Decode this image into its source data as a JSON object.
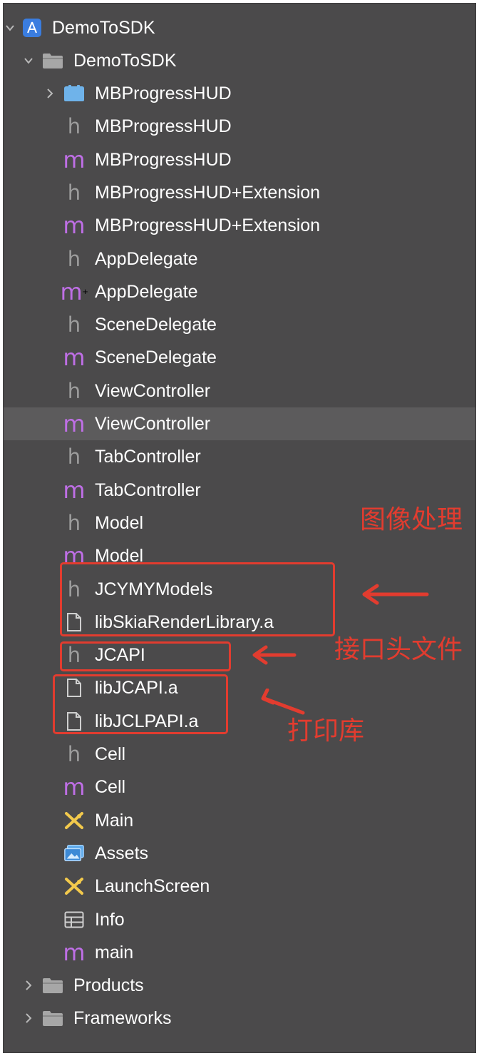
{
  "navigator": {
    "project": {
      "label": "DemoToSDK",
      "icon": "app-project-icon"
    },
    "group": {
      "label": "DemoToSDK",
      "icon": "folder-icon"
    },
    "items": [
      {
        "label": "MBProgressHUD",
        "icon": "package-icon"
      },
      {
        "label": "MBProgressHUD",
        "icon": "header-file-icon",
        "glyph": "h"
      },
      {
        "label": "MBProgressHUD",
        "icon": "objc-file-icon",
        "glyph": "m"
      },
      {
        "label": "MBProgressHUD+Extension",
        "icon": "header-file-icon",
        "glyph": "h"
      },
      {
        "label": "MBProgressHUD+Extension",
        "icon": "objc-file-icon",
        "glyph": "m"
      },
      {
        "label": "AppDelegate",
        "icon": "header-file-icon",
        "glyph": "h"
      },
      {
        "label": "AppDelegate",
        "icon": "objcpp-file-icon",
        "glyph": "m",
        "sup": "+"
      },
      {
        "label": "SceneDelegate",
        "icon": "header-file-icon",
        "glyph": "h"
      },
      {
        "label": "SceneDelegate",
        "icon": "objc-file-icon",
        "glyph": "m"
      },
      {
        "label": "ViewController",
        "icon": "header-file-icon",
        "glyph": "h"
      },
      {
        "label": "ViewController",
        "icon": "objc-file-icon",
        "glyph": "m"
      },
      {
        "label": "TabController",
        "icon": "header-file-icon",
        "glyph": "h"
      },
      {
        "label": "TabController",
        "icon": "objc-file-icon",
        "glyph": "m"
      },
      {
        "label": "Model",
        "icon": "header-file-icon",
        "glyph": "h"
      },
      {
        "label": "Model",
        "icon": "objc-file-icon",
        "glyph": "m"
      },
      {
        "label": "JCYMYModels",
        "icon": "header-file-icon",
        "glyph": "h"
      },
      {
        "label": "libSkiaRenderLibrary.a",
        "icon": "document-icon"
      },
      {
        "label": "JCAPI",
        "icon": "header-file-icon",
        "glyph": "h"
      },
      {
        "label": "libJCAPI.a",
        "icon": "document-icon"
      },
      {
        "label": "libJCLPAPI.a",
        "icon": "document-icon"
      },
      {
        "label": "Cell",
        "icon": "header-file-icon",
        "glyph": "h"
      },
      {
        "label": "Cell",
        "icon": "objc-file-icon",
        "glyph": "m"
      },
      {
        "label": "Main",
        "icon": "storyboard-icon"
      },
      {
        "label": "Assets",
        "icon": "asset-catalog-icon"
      },
      {
        "label": "LaunchScreen",
        "icon": "storyboard-icon"
      },
      {
        "label": "Info",
        "icon": "plist-table-icon"
      },
      {
        "label": "main",
        "icon": "objc-file-icon",
        "glyph": "m"
      }
    ],
    "bottom_groups": [
      {
        "label": "Products",
        "icon": "folder-icon"
      },
      {
        "label": "Frameworks",
        "icon": "folder-icon"
      }
    ],
    "selected_label": "ViewController"
  },
  "annotations": {
    "image_processing": "图像处理",
    "interface_header": "接口头文件",
    "print_library": "打印库"
  },
  "colors": {
    "background": "#4b4a4b",
    "selection": "#5c5b5c",
    "header_glyph": "#9c9c9c",
    "objc_glyph": "#bf6fe6",
    "annotation": "#e23c2f"
  }
}
